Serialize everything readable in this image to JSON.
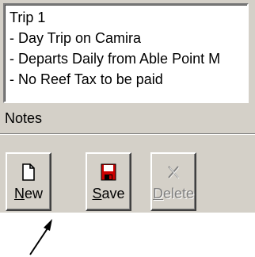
{
  "notes": {
    "lines": [
      "Trip 1",
      "- Day Trip on Camira",
      "- Departs Daily from Able Point M",
      "- No Reef Tax to be paid"
    ],
    "label": "Notes"
  },
  "toolbar": {
    "new": {
      "mnemonic": "N",
      "rest": "ew",
      "icon": "new-document-icon",
      "enabled": true
    },
    "save": {
      "mnemonic": "S",
      "rest": "ave",
      "icon": "floppy-disk-icon",
      "enabled": true,
      "icon_color": "#cc0000"
    },
    "delete": {
      "mnemonic": "D",
      "rest": "elete",
      "icon": "delete-x-icon",
      "enabled": false
    }
  },
  "colors": {
    "face": "#d4d0c8",
    "disabled_text": "#808080"
  }
}
